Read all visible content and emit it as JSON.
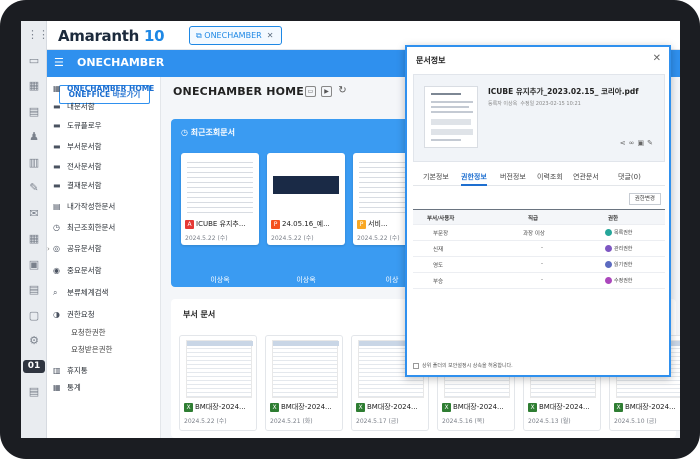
{
  "app": {
    "logo": "Amaranth",
    "logo_version": "10",
    "open_tab": "ONECHAMBER",
    "module_title": "ONECHAMBER"
  },
  "rail": {
    "icons": [
      "apps-icon",
      "monitor-icon",
      "calculator-icon",
      "ledger-icon",
      "people-icon",
      "chart-icon",
      "edit-icon",
      "mail-icon",
      "calendar-icon",
      "book-icon",
      "clipboard-icon",
      "pdf-icon",
      "settings-icon",
      "onechamber-icon",
      "printer-icon"
    ]
  },
  "sidebar": {
    "primary_button": "ONEFFICE 바로가기",
    "items": [
      {
        "label": "ONECHAMBER HOME",
        "icon": "grid-icon"
      },
      {
        "label": "내문서함",
        "icon": "folder-icon"
      },
      {
        "label": "도큐플로우",
        "icon": "folder-icon"
      },
      {
        "label": "부서문서함",
        "icon": "folder-icon"
      },
      {
        "label": "전사문서함",
        "icon": "folder-icon"
      },
      {
        "label": "결재문서함",
        "icon": "folder-icon"
      },
      {
        "label": "내가작성한문서",
        "icon": "document-icon"
      },
      {
        "label": "최근조회한문서",
        "icon": "clock-icon"
      },
      {
        "label": "공유문서함",
        "icon": "share-icon"
      },
      {
        "label": "중요문서함",
        "icon": "star-icon"
      },
      {
        "label": "분류체계검색",
        "icon": "search-icon"
      },
      {
        "label": "권한요청",
        "icon": "lock-icon"
      },
      {
        "label": "요청한권한",
        "icon": ""
      },
      {
        "label": "요청받은권한",
        "icon": ""
      },
      {
        "label": "휴지통",
        "icon": "trash-icon"
      },
      {
        "label": "통계",
        "icon": "stats-icon"
      }
    ]
  },
  "main": {
    "title": "ONECHAMBER HOME",
    "recent": {
      "heading": "최근조회문서",
      "cards": [
        {
          "name": "ICUBE 유지추...",
          "date": "2024.5.22 (수)",
          "owner": "이상옥",
          "type": "PDF",
          "color": "#e53935"
        },
        {
          "name": "24.05.16_예...",
          "date": "2024.5.22 (수)",
          "owner": "이상옥",
          "type": "P",
          "color": "#f4511e"
        },
        {
          "name": "서비...",
          "date": "2024.5.22 (수)",
          "owner": "이상",
          "type": "P",
          "color": "#f9a825"
        }
      ]
    },
    "dept": {
      "heading": "부서 문서",
      "cards": [
        {
          "name": "BM대장-2024...",
          "date": "2024.5.22 (수)"
        },
        {
          "name": "BM대장-2024...",
          "date": "2024.5.21 (화)"
        },
        {
          "name": "BM대장-2024...",
          "date": "2024.5.17 (금)"
        },
        {
          "name": "BM대장-2024...",
          "date": "2024.5.16 (목)"
        },
        {
          "name": "BM대장-2024...",
          "date": "2024.5.13 (월)"
        },
        {
          "name": "BM대장-2024...",
          "date": "2024.5.10 (금)"
        }
      ]
    }
  },
  "modal": {
    "title": "문서정보",
    "doc_name": "ICUBE 유지추가_2023.02.15_   코리아.pdf",
    "meta_owner": "등록자 이상옥",
    "meta_date": "수정일 2023-02-15 10:21",
    "tabs": [
      "기본정보",
      "권한정보",
      "버전정보",
      "이력조회",
      "연관문서",
      "댓글(0)"
    ],
    "active_tab": 1,
    "perm_button": "권한변경",
    "table": {
      "headers": [
        "부서/사용자",
        "직급",
        "권한"
      ],
      "rows": [
        {
          "user": "부문장",
          "rank": "과장 이상",
          "perm": "목록권한",
          "color": "#26a69a"
        },
        {
          "user": "신재",
          "rank": "-",
          "perm": "관리권한",
          "color": "#7e57c2"
        },
        {
          "user": "영도",
          "rank": "-",
          "perm": "읽기권한",
          "color": "#5c6bc0"
        },
        {
          "user": "부승",
          "rank": "-",
          "perm": "수정권한",
          "color": "#ab47bc"
        }
      ]
    },
    "footer": "상위 폴더의 보안설정시 상속을 허용합니다."
  }
}
